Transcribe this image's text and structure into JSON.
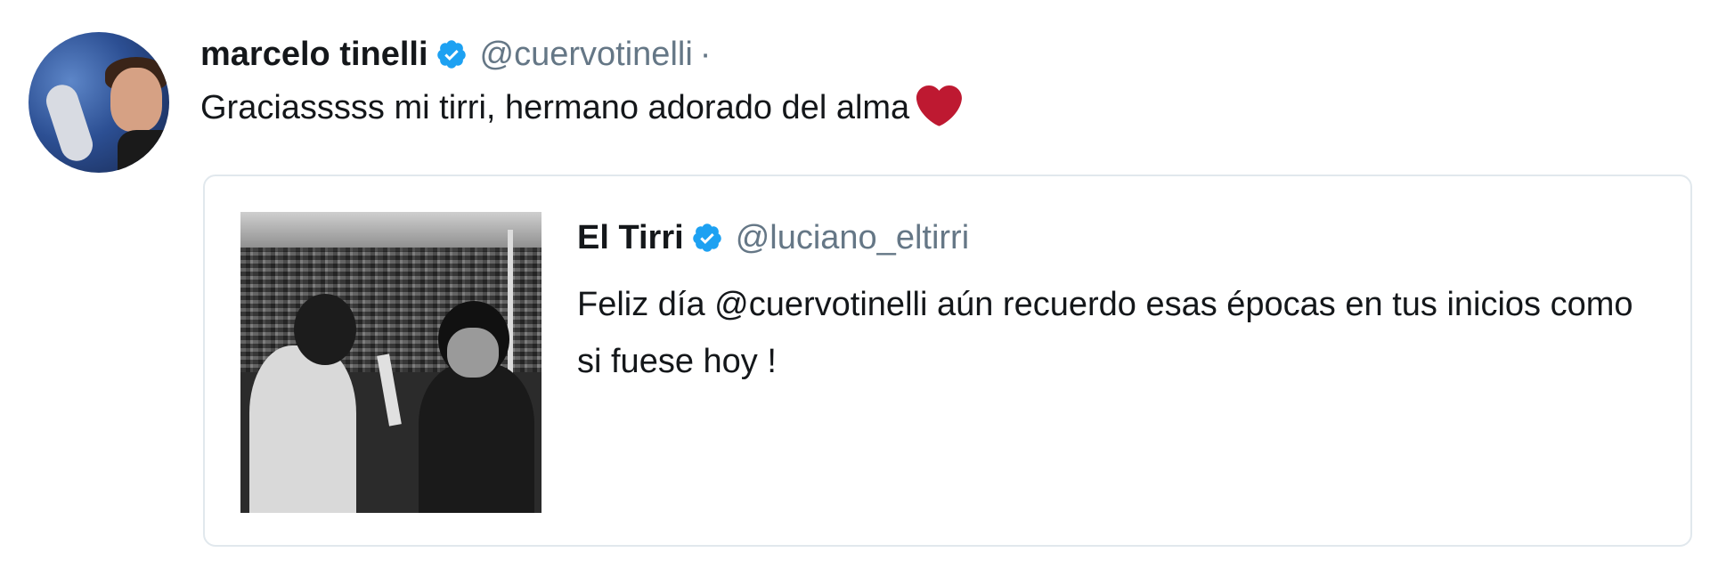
{
  "tweet": {
    "author_name": "marcelo tinelli",
    "author_handle": "@cuervotinelli",
    "separator": "·",
    "text": "Graciasssss mi tirri, hermano adorado del alma",
    "emoji": "heart-emoji",
    "verified_icon": "verified-badge-icon",
    "verified_color": "#1da1f2"
  },
  "quoted_tweet": {
    "author_name": "El Tirri",
    "author_handle": "@luciano_eltirri",
    "text": "Feliz día @cuervotinelli  aún recuerdo esas épocas en tus inicios como si fuese hoy !",
    "media": "black-and-white-photo"
  },
  "colors": {
    "handle_gray": "#657786",
    "heart_red": "#be1931",
    "border": "#e1e8ed"
  }
}
